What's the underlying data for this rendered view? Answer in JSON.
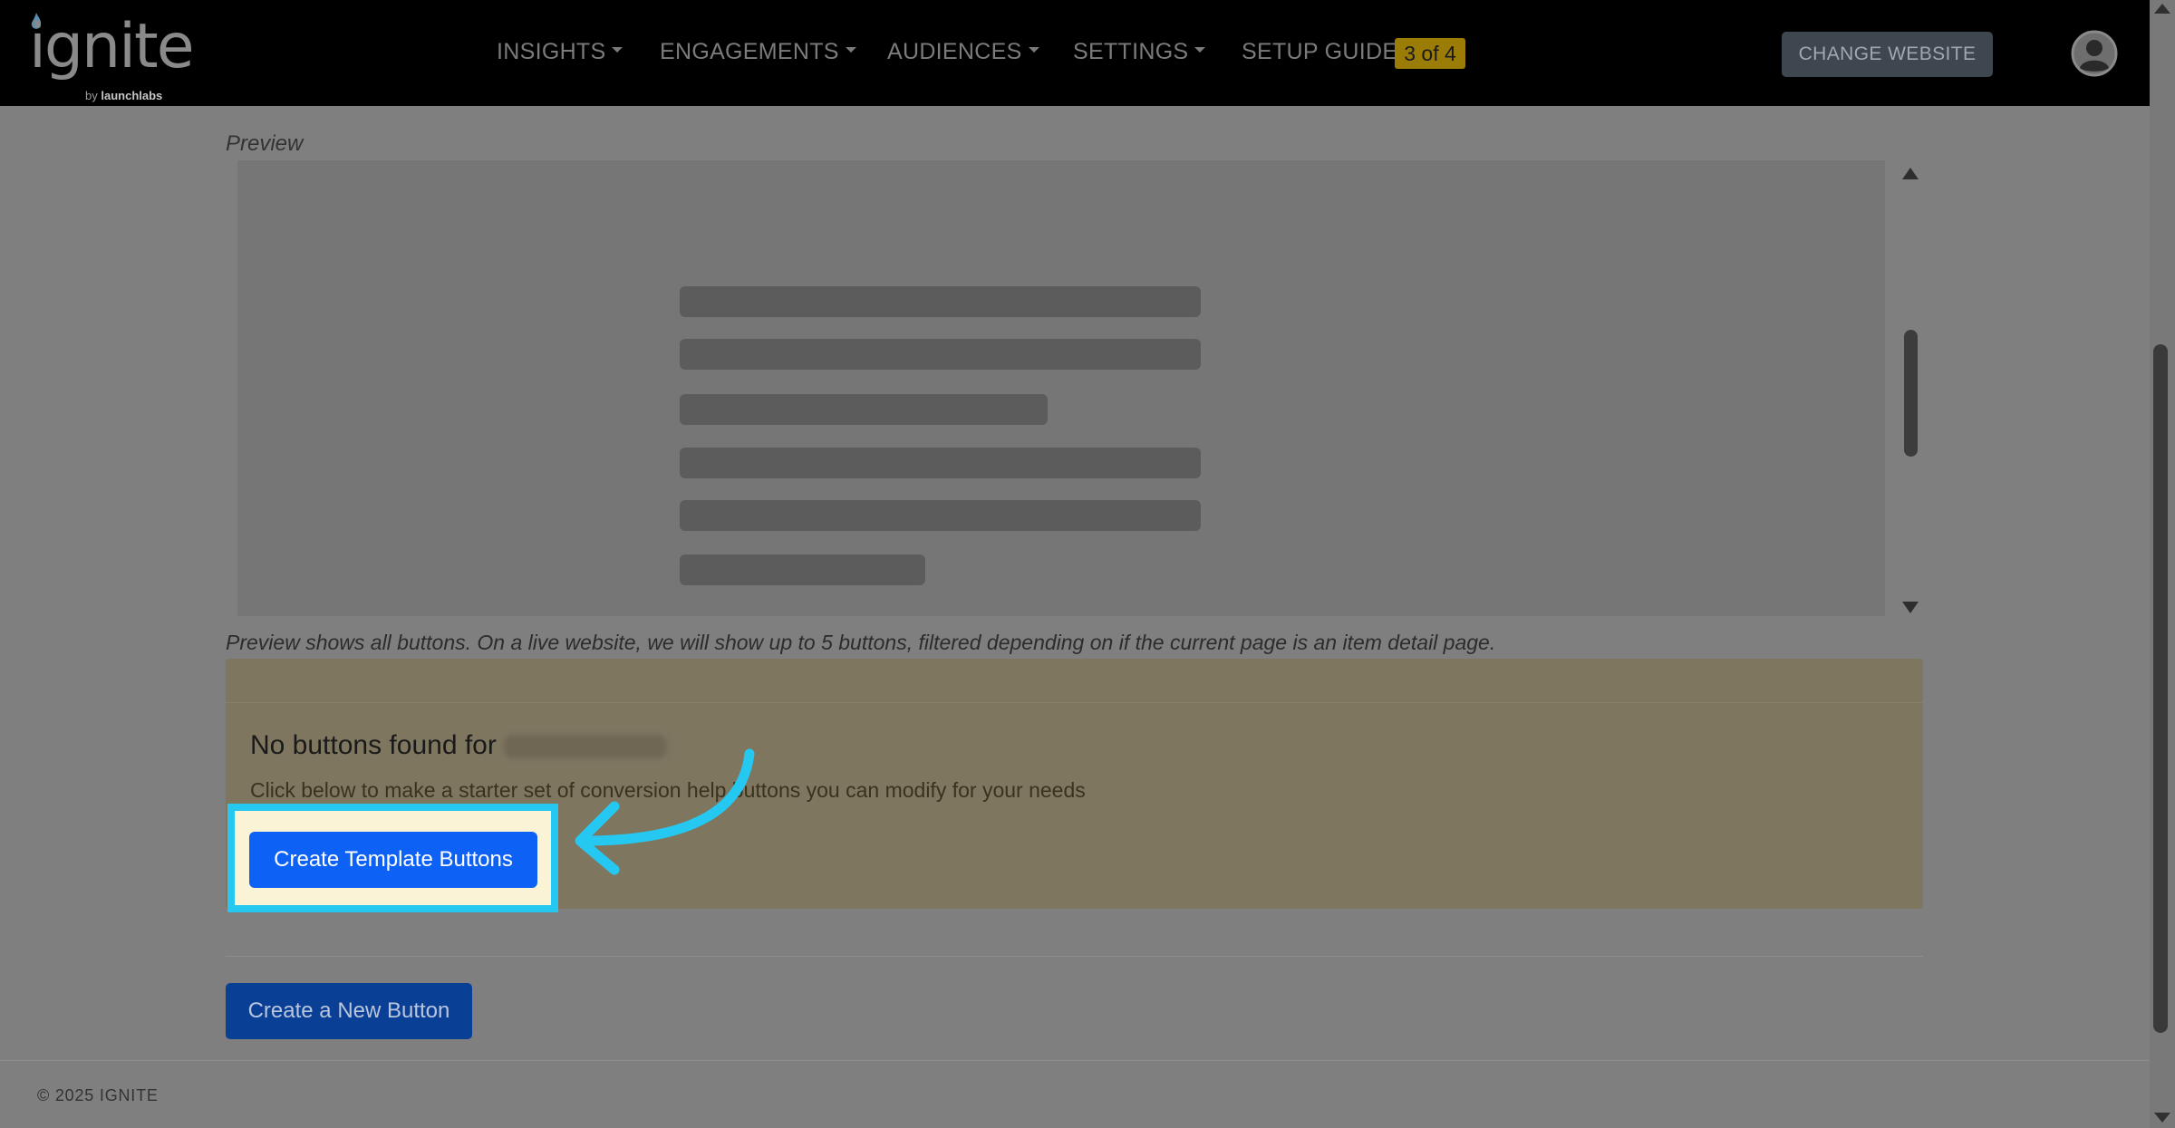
{
  "navbar": {
    "logo_text": "ignite",
    "logo_by": "by",
    "logo_brand": "launchlabs",
    "menu": [
      {
        "label": "INSIGHTS"
      },
      {
        "label": "ENGAGEMENTS"
      },
      {
        "label": "AUDIENCES"
      },
      {
        "label": "SETTINGS"
      }
    ],
    "setup_guide": {
      "label": "SETUP GUIDE",
      "badge": "3 of 4"
    },
    "change_website_label": "CHANGE WEBSITE",
    "avatar_icon": "user-circle-icon"
  },
  "preview": {
    "label": "Preview",
    "note": "Preview shows all buttons. On a live website, we will show up to 5 buttons, filtered depending on if the current page is an item detail page."
  },
  "alert": {
    "title": "No buttons found for",
    "description": "Click below to make a starter set of conversion help buttons you can modify for your needs",
    "button_label": "Create Template Buttons"
  },
  "new_button_label": "Create a New Button",
  "footer": {
    "copyright": "© 2025 IGNITE"
  },
  "colors": {
    "navbar_bg": "#000000",
    "primary_button": "#0d62f5",
    "highlight_border": "#25c8f0",
    "badge": "#9b7c07"
  }
}
